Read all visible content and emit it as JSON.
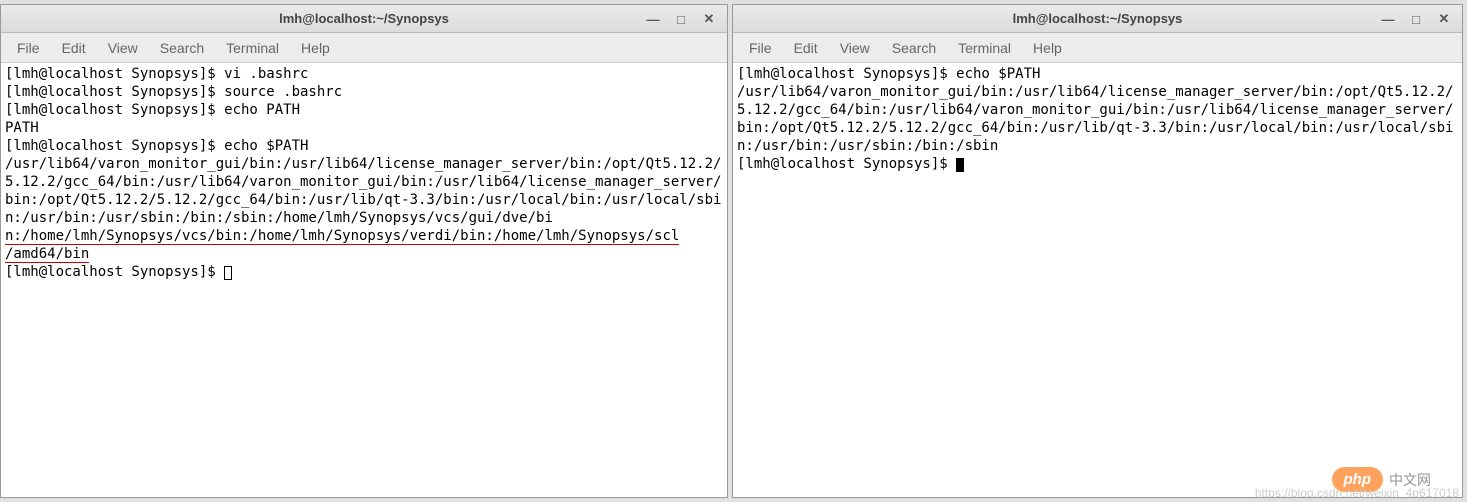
{
  "top_fragment": "",
  "window_left": {
    "title": "lmh@localhost:~/Synopsys",
    "controls": {
      "min": "—",
      "max": "□",
      "close": "✕"
    },
    "menu": [
      "File",
      "Edit",
      "View",
      "Search",
      "Terminal",
      "Help"
    ],
    "lines": [
      {
        "text": "[lmh@localhost Synopsys]$ vi .bashrc"
      },
      {
        "text": "[lmh@localhost Synopsys]$ source .bashrc"
      },
      {
        "text": "[lmh@localhost Synopsys]$ echo PATH"
      },
      {
        "text": "PATH"
      },
      {
        "text": "[lmh@localhost Synopsys]$ echo $PATH"
      },
      {
        "text": "/usr/lib64/varon_monitor_gui/bin:/usr/lib64/license_manager_server/bin:/opt/Qt5.12.2/5.12.2/gcc_64/bin:/usr/lib64/varon_monitor_gui/bin:/usr/lib64/license_manager_server/bin:/opt/Qt5.12.2/5.12.2/gcc_64/bin:/usr/lib/qt-3.3/bin:/usr/local/bin:/usr/local/sbin:/usr/bin:/usr/sbin:/bin:/sbin:/home/lmh/Synopsys/vcs/gui/dve/bi"
      },
      {
        "text": "n:/home/lmh/Synopsys/vcs/bin:/home/lmh/Synopsys/verdi/bin:/home/lmh/Synopsys/scl",
        "underline": true
      },
      {
        "text": "/amd64/bin",
        "underline": true
      },
      {
        "text": "[lmh@localhost Synopsys]$ ",
        "cursor": "box"
      }
    ]
  },
  "window_right": {
    "title": "lmh@localhost:~/Synopsys",
    "controls": {
      "min": "—",
      "max": "□",
      "close": "✕"
    },
    "menu": [
      "File",
      "Edit",
      "View",
      "Search",
      "Terminal",
      "Help"
    ],
    "lines": [
      {
        "text": "[lmh@localhost Synopsys]$ echo $PATH"
      },
      {
        "text": "/usr/lib64/varon_monitor_gui/bin:/usr/lib64/license_manager_server/bin:/opt/Qt5.12.2/5.12.2/gcc_64/bin:/usr/lib64/varon_monitor_gui/bin:/usr/lib64/license_manager_server/bin:/opt/Qt5.12.2/5.12.2/gcc_64/bin:/usr/lib/qt-3.3/bin:/usr/local/bin:/usr/local/sbin:/usr/bin:/usr/sbin:/bin:/sbin"
      },
      {
        "text": "[lmh@localhost Synopsys]$ ",
        "cursor": "block"
      }
    ]
  },
  "watermark": {
    "logo_text": "php",
    "cn_text": "中文网",
    "url_text": "https://blog.csdn.net/weixin_4p617018"
  }
}
